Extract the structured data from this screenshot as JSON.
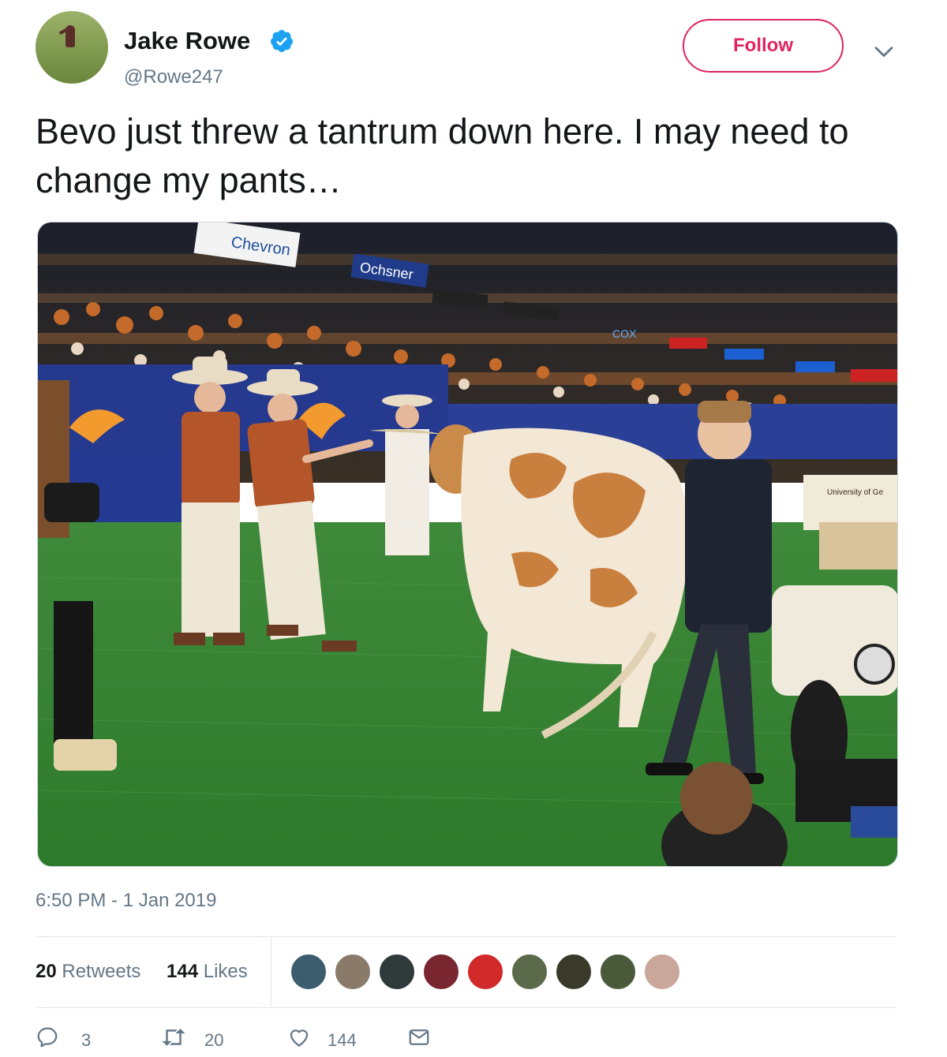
{
  "user": {
    "name": "Jake Rowe",
    "handle": "@Rowe247",
    "verified": true,
    "avatar_icon": "avatar-golfer-photo"
  },
  "follow_button": {
    "label": "Follow",
    "color": "#e0245e"
  },
  "tweet": {
    "text": "Bevo just threw a tantrum down here. I may need to change my pants…",
    "timestamp": "6:50 PM - 1 Jan 2019"
  },
  "photo": {
    "signs": {
      "chevron": "Chevron",
      "ochsner": "Ochsner",
      "cox": "COX",
      "cart": "University of Ge"
    }
  },
  "stats": {
    "retweets_count": "20",
    "retweets_label": "Retweets",
    "likes_count": "144",
    "likes_label": "Likes"
  },
  "likers": [
    {
      "icon": "liker-avatar-1",
      "color": "#3b5d6e"
    },
    {
      "icon": "liker-avatar-2",
      "color": "#8a7a6a"
    },
    {
      "icon": "liker-avatar-3",
      "color": "#2f3a3a"
    },
    {
      "icon": "liker-avatar-4",
      "color": "#7a2630"
    },
    {
      "icon": "liker-avatar-5",
      "color": "#d22a2a"
    },
    {
      "icon": "liker-avatar-6",
      "color": "#5a6a4a"
    },
    {
      "icon": "liker-avatar-7",
      "color": "#3a3a2a"
    },
    {
      "icon": "liker-avatar-8",
      "color": "#4a5a3a"
    },
    {
      "icon": "liker-avatar-9",
      "color": "#c9a79a"
    }
  ],
  "actions": {
    "reply_count": "3",
    "retweet_count": "20",
    "like_count": "144",
    "message_icon": "envelope-icon"
  }
}
